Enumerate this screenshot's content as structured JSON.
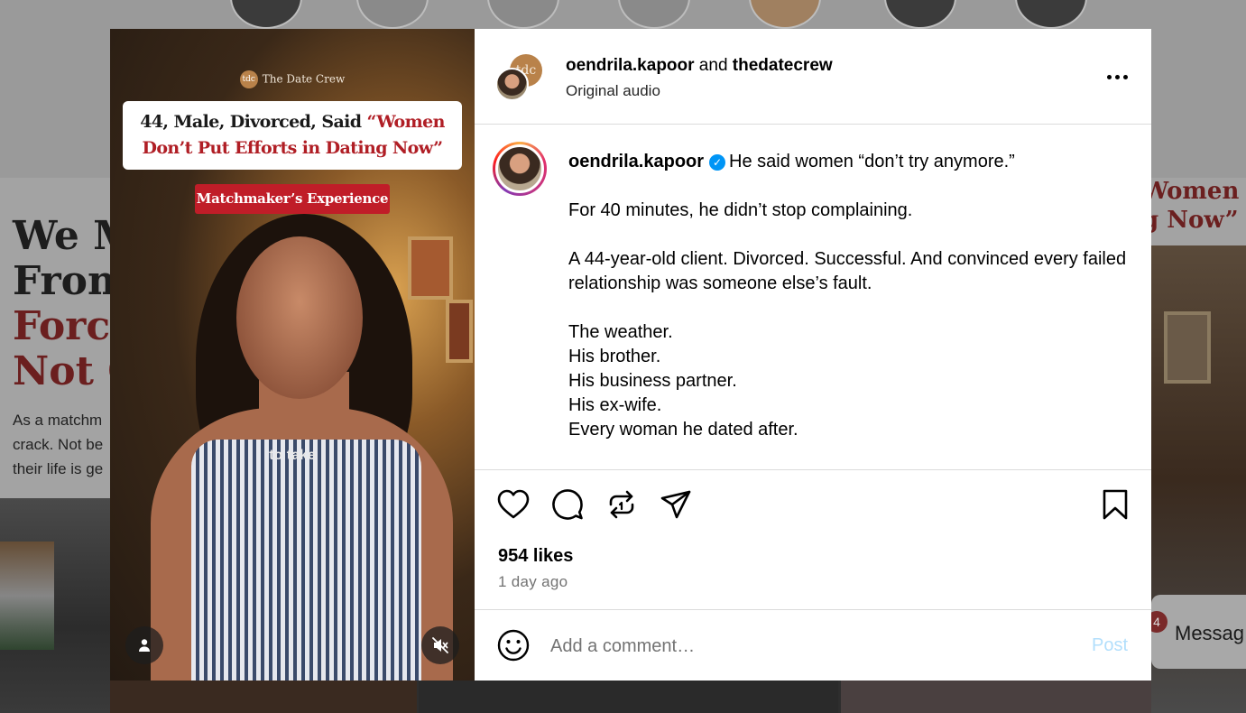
{
  "background": {
    "left_headline": [
      "We M",
      "From",
      "Force",
      "Not O"
    ],
    "left_body": [
      "As a matchm",
      "crack. Not be",
      "their life is ge"
    ],
    "right_headline": [
      "Women",
      "g Now”"
    ],
    "message_badge": "4",
    "message_label": "Messag"
  },
  "media": {
    "brand_logo": "tdc",
    "brand_name": "The Date Crew",
    "headline_part1": "44, Male, Divorced, Said ",
    "headline_part2": "“Women Don’t Put Efforts in Dating Now”",
    "tag": "Matchmaker’s Experience",
    "caption": "to take",
    "icons": {
      "user": "user-icon",
      "mute": "volume-off-icon"
    }
  },
  "header": {
    "avatar_back_text": "tdc",
    "user1": "oendrila.kapoor",
    "joiner": " and ",
    "user2": "thedatecrew",
    "audio": "Original audio"
  },
  "caption_post": {
    "username": "oendrila.kapoor",
    "verified_glyph": "✓",
    "first_line": "He said women “don’t try anymore.”",
    "para2": "For 40 minutes, he didn’t stop complaining.",
    "para3": "A 44-year-old client. Divorced. Successful. And convinced every failed relationship was someone else’s fault.",
    "list": [
      "The weather.",
      "His brother.",
      "His business partner.",
      "His ex-wife.",
      "Every woman he dated after."
    ]
  },
  "actions": {
    "likes": "954 likes",
    "time": "1 day ago",
    "icons": [
      "heart-icon",
      "comment-icon",
      "repost-icon",
      "share-icon",
      "bookmark-icon"
    ]
  },
  "comment_box": {
    "placeholder": "Add a comment…",
    "post_label": "Post"
  },
  "colors": {
    "accent": "#0095f6",
    "post_disabled": "#b2dffc",
    "headline_red": "#b01e25",
    "tag_red": "#c01d28"
  }
}
